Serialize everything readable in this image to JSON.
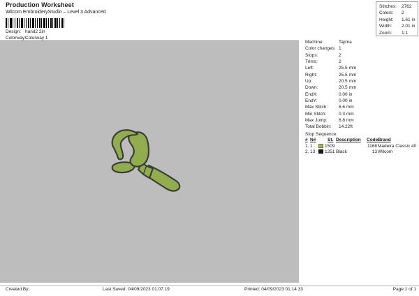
{
  "header": {
    "title": "Production Worksheet",
    "subtitle": "Wilcom EmbroideryStudio – Level 3 Advanced",
    "design": {
      "label": "Design:",
      "value": "hand2 2in"
    },
    "colorway": {
      "label": "Colorway:",
      "value": "Colorway 1"
    }
  },
  "stats_box": {
    "rows": [
      {
        "label": "Stitches:",
        "value": "2762"
      },
      {
        "label": "Colors:",
        "value": "2"
      },
      {
        "label": "Height:",
        "value": "1.61 in"
      },
      {
        "label": "Width:",
        "value": "2.01 in"
      },
      {
        "label": "Zoom:",
        "value": "1:1"
      }
    ]
  },
  "machine_panel": {
    "rows": [
      {
        "label": "Machine:",
        "value": "Tajima"
      },
      {
        "label": "Color changes:",
        "value": "1"
      },
      {
        "label": "Stops:",
        "value": "2"
      },
      {
        "label": "Trims:",
        "value": "2"
      },
      {
        "label": "Left:",
        "value": "25.5 mm"
      },
      {
        "label": "Right:",
        "value": "25.5 mm"
      },
      {
        "label": "Up:",
        "value": "20.5 mm"
      },
      {
        "label": "Down:",
        "value": "20.5 mm"
      },
      {
        "label": "EndX:",
        "value": "0.00 in"
      },
      {
        "label": "EndY:",
        "value": "0.00 in"
      },
      {
        "label": "Max Stitch:",
        "value": "6.6 mm"
      },
      {
        "label": "Min Stitch:",
        "value": "0.3 mm"
      },
      {
        "label": "Max Jump:",
        "value": "6.8 mm"
      },
      {
        "label": "Total Bobbin:",
        "value": "14.22ft"
      }
    ],
    "stop_sequence_label": "Stop Sequence:",
    "table": {
      "headers": {
        "num": "#",
        "needle": "N#",
        "st": "St.",
        "description": "Description",
        "code": "Code",
        "brand": "Brand"
      },
      "rows": [
        {
          "num": "1.",
          "needle": "1",
          "swatch_color": "#a3b25b",
          "st": "1509",
          "description": "",
          "code": "1168",
          "brand": "Madeira Classic 40"
        },
        {
          "num": "2.",
          "needle": "13",
          "swatch_color": "#161616",
          "st": "1251",
          "description": "Black",
          "code": "13",
          "brand": "Wilcom"
        }
      ]
    }
  },
  "design_canvas": {
    "design_name": "hand2 embroidery design",
    "background": "#bdbdbd",
    "thread_fill": "#93af50",
    "thread_shade": "#83a044",
    "outline": "#3e3e38"
  },
  "footer": {
    "created_by": "Created By:",
    "last_saved": "Last Saved: 04/09/2023 01.07.19",
    "printed": "Printed: 04/09/2023 01.14.33",
    "page": "Page 1 of 1"
  }
}
